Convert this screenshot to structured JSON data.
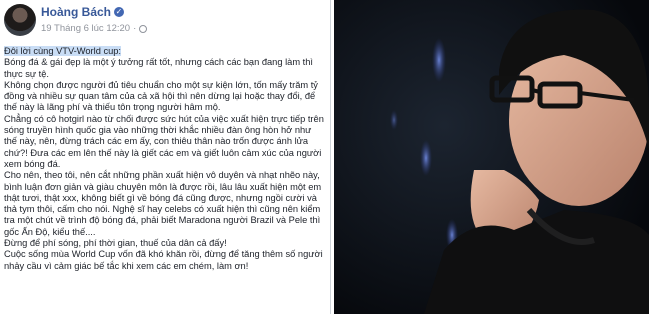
{
  "post": {
    "author": "Hoàng Bách",
    "timestamp": "19 Tháng 6 lúc 12:20",
    "paragraphs": [
      "Đôi lời cùng VTV-World cup:",
      "Bóng đá & gái đẹp là một ý tưởng rất tốt, nhưng cách các bạn đang làm thì thực sự tệ.",
      "Không chọn được người đủ tiêu chuẩn cho một sự kiện lớn, tốn mấy trăm tỷ đồng và nhiều sự quan tâm của cả xã hội thì nên dừng lại hoặc thay đổi, để thế này là lãng phí và thiếu tôn trọng người hâm mộ.",
      "Chẳng có cô hotgirl nào từ chối được sức hút của việc xuất hiện trực tiếp trên sóng truyền hình quốc gia vào những thời khắc nhiều đàn ông hòn hở như thế này, nên, đừng trách các em ấy, con thiêu thân nào trốn được ánh lửa chứ?! Đưa các em lên thế này là giết các em và giết luôn cảm xúc của người xem bóng đá.",
      "Cho nên, theo tôi, nên cắt những phần xuất hiện vô duyên và nhạt nhẽo này, bình luận đơn giản và giàu chuyên môn là được rồi, lâu lâu xuất hiện một em thật tươi, thật xxx, không biết gì về bóng đá cũng được, nhưng ngồi cười và thả tym thôi, cấm cho nói. Nghệ sĩ hay celebs có xuất hiện thì cũng nên kiểm tra một chút về trình độ bóng đá, phải biết Maradona người Brazil và Pele thì gốc Ấn Độ, kiểu thế....",
      "Đừng để phí sóng, phí thời gian, thuế của dân cả đấy!",
      "Cuộc sống mùa World Cup vốn đã khó khăn rồi, đừng để tăng thêm số người nhảy cầu vì cảm giác bế tắc khi xem các em chém, làm ơn!"
    ]
  },
  "photo": {
    "description_icon": "man-in-glasses-photo"
  }
}
